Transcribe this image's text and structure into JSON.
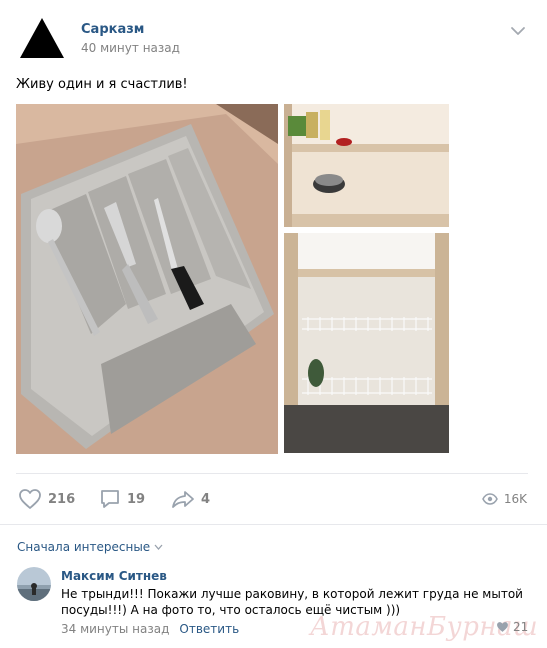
{
  "post": {
    "author": "Сарказм",
    "time": "40 минут назад",
    "text": "Живу один и я счастлив!"
  },
  "actions": {
    "likes": "216",
    "comments": "19",
    "shares": "4",
    "views": "16K"
  },
  "comments_section": {
    "sort_label": "Сначала интересные"
  },
  "comment": {
    "author": "Максим Ситнев",
    "text": "Не трынди!!! Покажи лучше раковину, в которой лежит груда не мытой посуды!!!) А на фото то, что осталось ещё чистым )))",
    "time": "34 минуты назад",
    "reply_label": "Ответить",
    "likes": "21"
  },
  "watermark": "АтаманБурнаш для ЯП",
  "icons": {
    "avatar": "black-triangle",
    "menu": "chevron-down-icon",
    "like": "heart-icon",
    "comment": "speech-bubble-icon",
    "share": "share-arrow-icon",
    "views": "eye-icon"
  },
  "colors": {
    "link": "#2a5885",
    "muted": "#828282",
    "divider": "#e7e8ec"
  }
}
